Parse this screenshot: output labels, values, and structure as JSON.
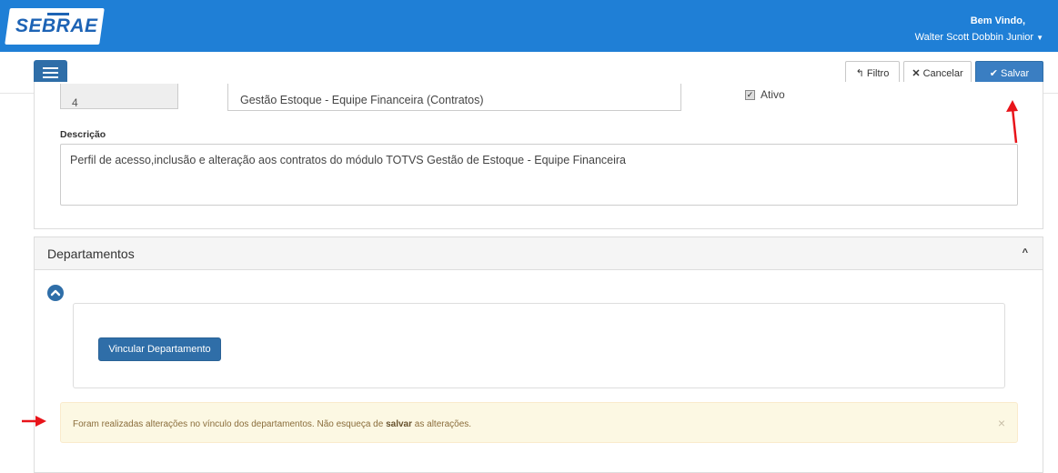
{
  "header": {
    "logo_text": "SEBRAE",
    "welcome": "Bem Vindo,",
    "username": "Walter Scott Dobbin Junior"
  },
  "toolbar": {
    "filtro_label": "Filtro",
    "cancelar_label": "Cancelar",
    "salvar_label": "Salvar"
  },
  "form": {
    "id_value": "4",
    "name_value": "Gestão Estoque - Equipe Financeira (Contratos)",
    "ativo_label": "Ativo",
    "ativo_checked": true,
    "descricao_label": "Descrição",
    "descricao_value": "Perfil de acesso,inclusão e alteração aos contratos do módulo TOTVS Gestão de Estoque - Equipe Financeira"
  },
  "departamentos": {
    "title": "Departamentos",
    "vincular_label": "Vincular Departamento",
    "alert_prefix": "Foram realizadas alterações no vínculo dos departamentos. Não esqueça de ",
    "alert_bold": "salvar",
    "alert_suffix": " as alterações."
  },
  "colors": {
    "header_bg": "#1f7fd6",
    "primary_button": "#2f6ea8",
    "alert_bg": "#fcf8e3",
    "annotation_arrow": "#e8141a"
  }
}
